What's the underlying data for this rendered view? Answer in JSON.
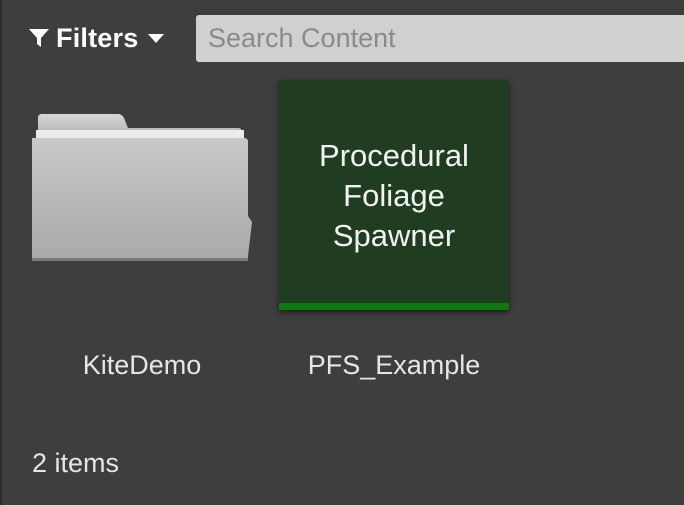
{
  "toolbar": {
    "filters_label": "Filters",
    "filters_icon": "funnel-icon",
    "dropdown_icon": "caret-down-icon",
    "search": {
      "value": "",
      "placeholder": "Search Content"
    }
  },
  "items": [
    {
      "type": "folder",
      "icon": "folder-icon",
      "label": "KiteDemo"
    },
    {
      "type": "asset",
      "thumbnail_text": "Procedural\nFoliage\nSpawner",
      "label": "PFS_Example",
      "thumbnail_color": "#213d21",
      "type_bar_color": "#0e7a0e"
    }
  ],
  "status": {
    "item_count": "2 items"
  },
  "colors": {
    "background": "#3e3e3e",
    "search_bg": "#d0d0d0",
    "text": "#e6e6e6"
  }
}
